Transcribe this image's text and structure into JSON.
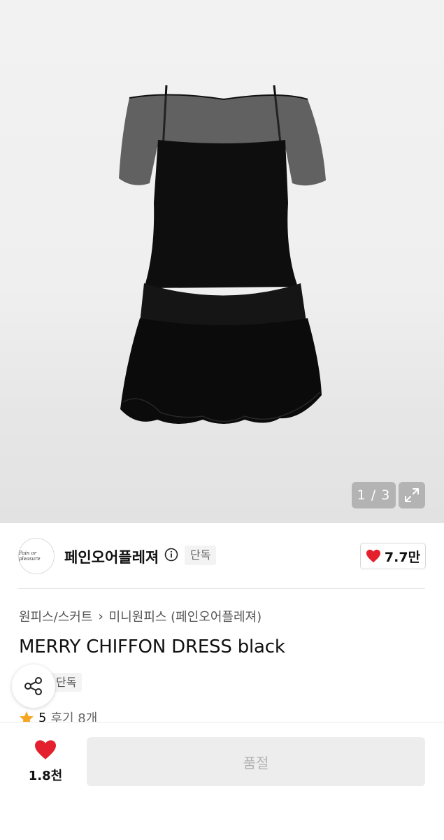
{
  "gallery": {
    "counter": "1 / 3",
    "expand_icon": "expand-icon"
  },
  "brand": {
    "logo_text": "Pain or pleasure",
    "name": "페인오어플레져",
    "info_icon": "info-icon",
    "badge": "단독",
    "like_count": "7.7만"
  },
  "product": {
    "breadcrumb": [
      "원피스/스커트",
      "미니원피스 (페인오어플레져)"
    ],
    "title": "MERRY CHIFFON DRESS black",
    "badge": "단독",
    "rating": "5",
    "reviews": "후기 8개"
  },
  "bottom": {
    "wish_count": "1.8천",
    "buy_button": "품절"
  },
  "colors": {
    "heart": "#e5202e",
    "star": "#f5a623",
    "soldout_bg": "#ededed"
  }
}
